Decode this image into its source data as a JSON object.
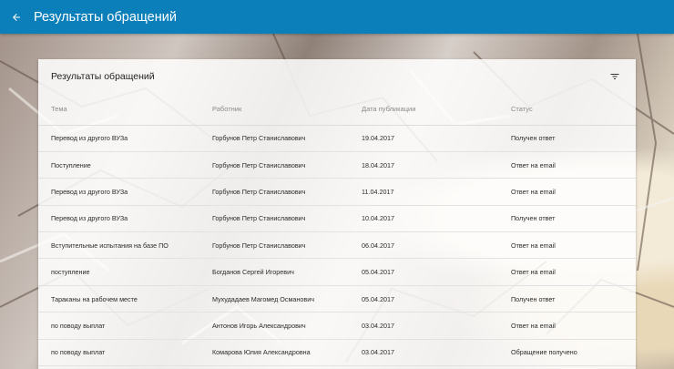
{
  "appbar": {
    "title": "Результаты обращений",
    "color": "#0b7fba",
    "back_icon": "arrow-back-icon"
  },
  "card": {
    "title": "Результаты обращений",
    "filter_icon": "filter-icon"
  },
  "table": {
    "headers": [
      "Тема",
      "Работник",
      "Дата публикации",
      "Статус"
    ],
    "rows": [
      [
        "Перевод из другого ВУЗа",
        "Горбунов Петр Станиславович",
        "19.04.2017",
        "Получен ответ"
      ],
      [
        "Поступление",
        "Горбунов Петр Станиславович",
        "18.04.2017",
        "Ответ на email"
      ],
      [
        "Перевод из другого ВУЗа",
        "Горбунов Петр Станиславович",
        "11.04.2017",
        "Ответ на email"
      ],
      [
        "Перевод из другого ВУЗа",
        "Горбунов Петр Станиславович",
        "10.04.2017",
        "Получен ответ"
      ],
      [
        "Вступительные испытания на базе ПО",
        "Горбунов Петр Станиславович",
        "06.04.2017",
        "Ответ на email"
      ],
      [
        "поступление",
        "Богданов Сергей Игоревич",
        "05.04.2017",
        "Ответ на email"
      ],
      [
        "Тараканы на рабочем месте",
        "Мухудадаев Магомед Османович",
        "05.04.2017",
        "Получен ответ"
      ],
      [
        "по поводу выплат",
        "Антонов Игорь Александрович",
        "03.04.2017",
        "Ответ на email"
      ],
      [
        "по поводу выплат",
        "Комарова Юлия Александровна",
        "03.04.2017",
        "Обращение получено"
      ]
    ]
  }
}
